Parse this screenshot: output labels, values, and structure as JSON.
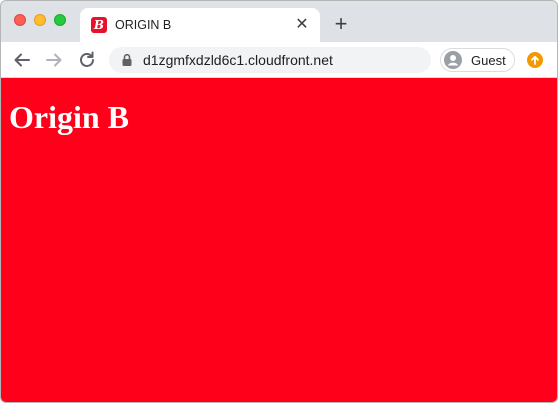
{
  "tab": {
    "title": "ORIGIN B",
    "favicon_letter": "B",
    "favicon_color": "#e8112d",
    "close_icon": "close-icon"
  },
  "toolbar": {
    "url": "d1zgmfxdzld6c1.cloudfront.net",
    "profile_label": "Guest",
    "icons": [
      "back-arrow-icon",
      "forward-arrow-icon",
      "reload-icon",
      "lock-icon",
      "avatar-icon",
      "update-icon"
    ]
  },
  "page": {
    "heading": "Origin B",
    "background_color": "#ff001b",
    "text_color": "#ffffff"
  }
}
